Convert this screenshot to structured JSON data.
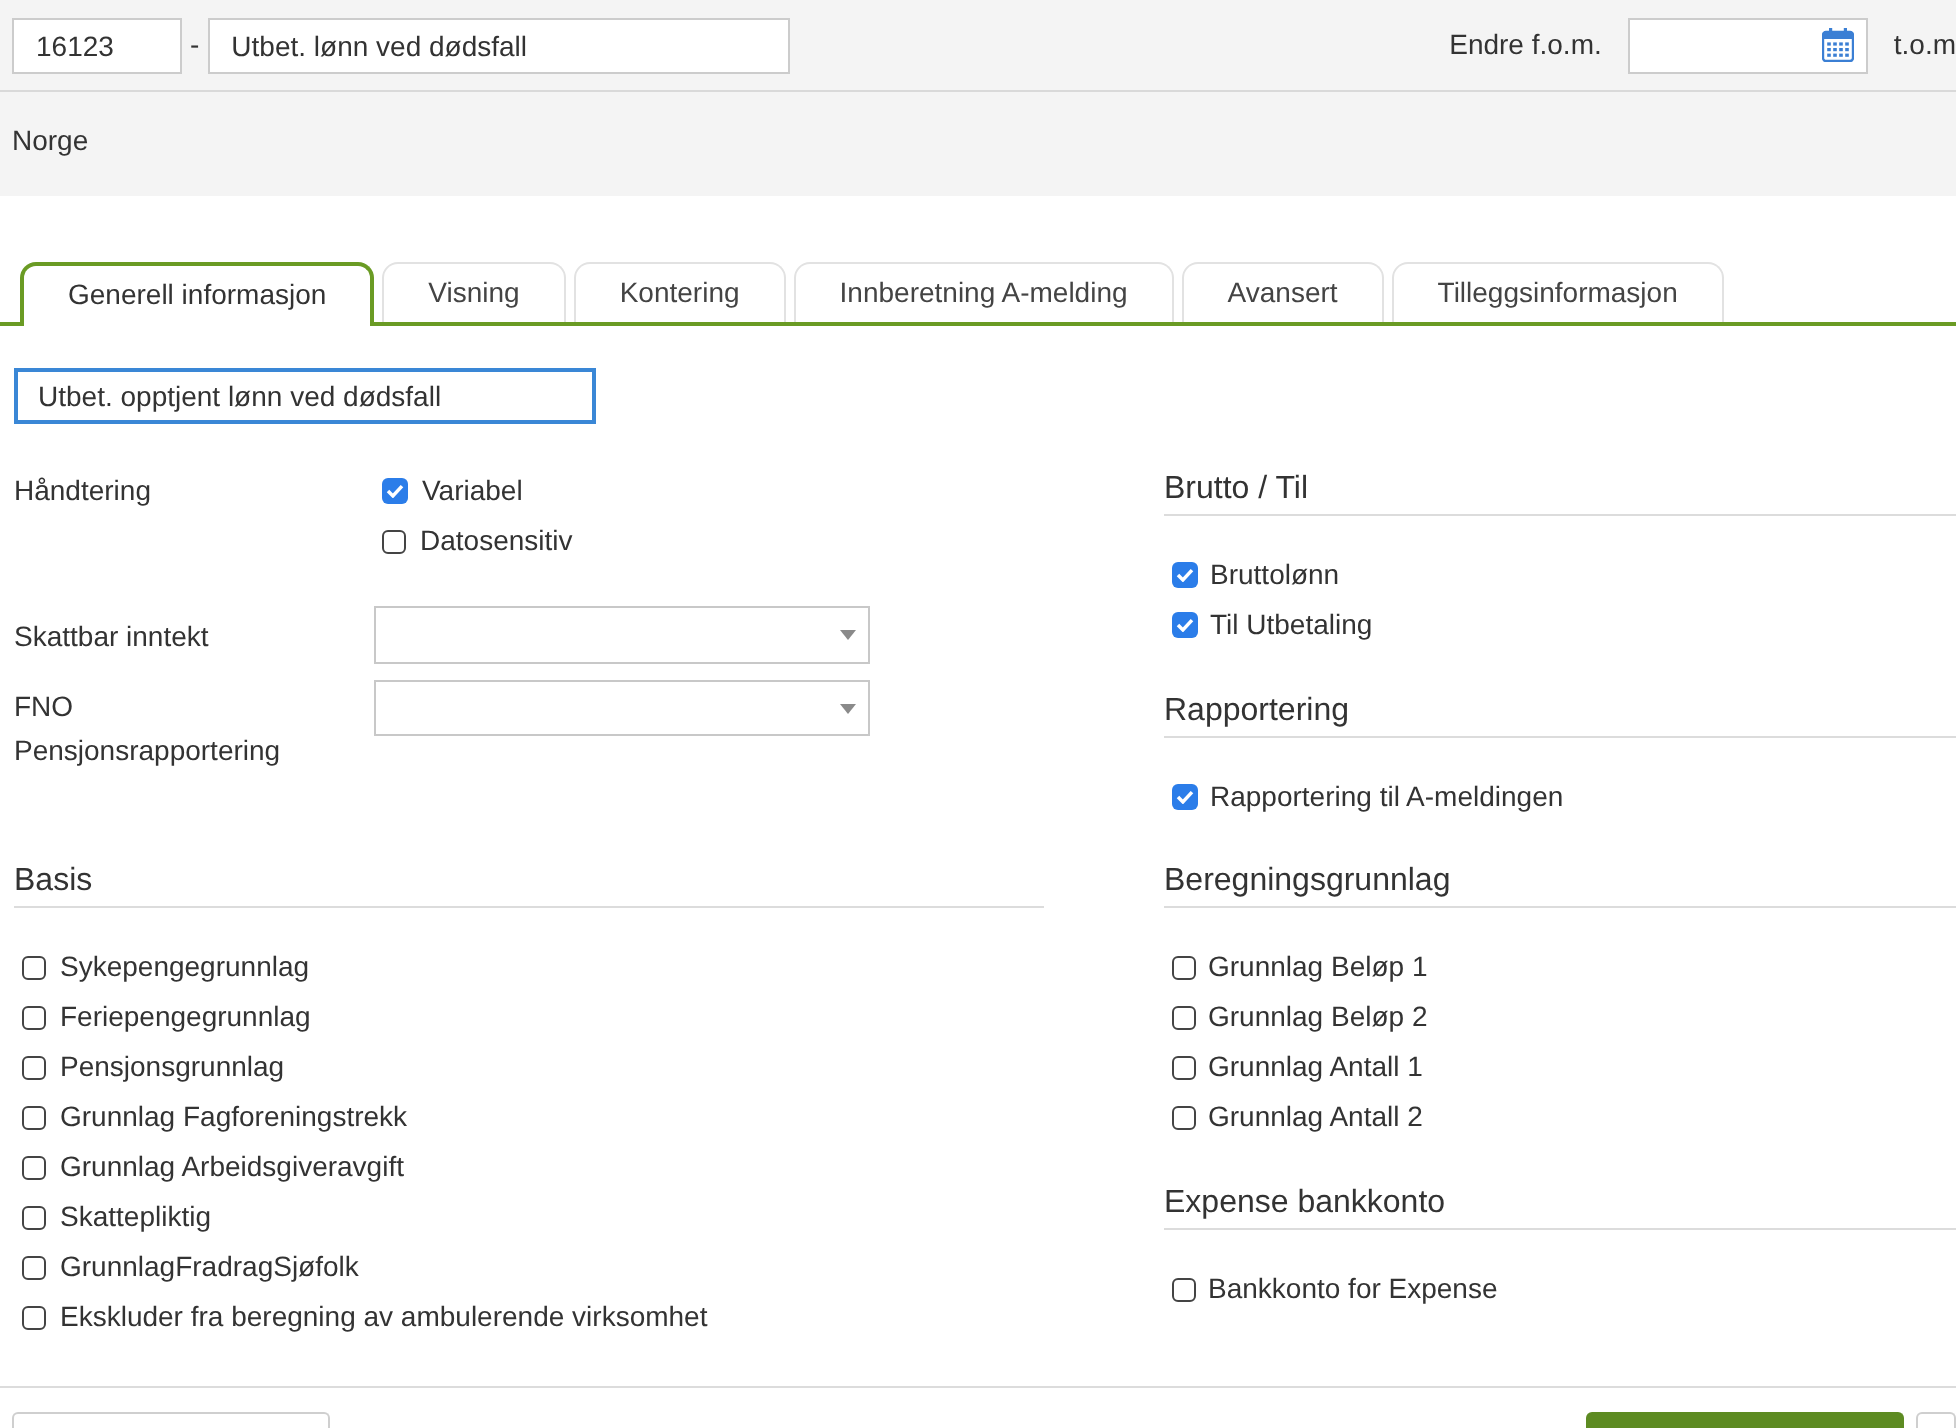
{
  "header": {
    "code": "16123",
    "separator": "-",
    "name": "Utbet. lønn ved dødsfall",
    "date_from": {
      "label": "Endre f.o.m."
    },
    "date_to": {
      "label": "t.o.m"
    }
  },
  "country": "Norge",
  "tabs": [
    {
      "label": "Generell informasjon",
      "selected": true
    },
    {
      "label": "Visning",
      "selected": false
    },
    {
      "label": "Kontering",
      "selected": false
    },
    {
      "label": "Innberetning A-melding",
      "selected": false
    },
    {
      "label": "Avansert",
      "selected": false
    },
    {
      "label": "Tilleggsinformasjon",
      "selected": false
    }
  ],
  "description": {
    "value": "Utbet. opptjent lønn ved dødsfall",
    "focused": true
  },
  "handling": {
    "label": "Håndtering",
    "options": [
      {
        "label": "Variabel",
        "checked": true
      },
      {
        "label": "Datosensitiv",
        "checked": false
      }
    ]
  },
  "selects": [
    {
      "label": "Skattbar inntekt"
    },
    {
      "label": "FNO Pensjonsrapportering"
    }
  ],
  "left_sections": [
    {
      "title": "Basis",
      "items": [
        {
          "label": "Sykepengegrunnlag",
          "checked": false
        },
        {
          "label": "Feriepengegrunnlag",
          "checked": false
        },
        {
          "label": "Pensjonsgrunnlag",
          "checked": false
        },
        {
          "label": "Grunnlag Fagforeningstrekk",
          "checked": false
        },
        {
          "label": "Grunnlag Arbeidsgiveravgift",
          "checked": false
        },
        {
          "label": "Skattepliktig",
          "checked": false
        },
        {
          "label": "GrunnlagFradragSjøfolk",
          "checked": false
        },
        {
          "label": "Ekskluder fra beregning av ambulerende virksomhet",
          "checked": false
        }
      ]
    }
  ],
  "right_sections_top": [
    {
      "title": "Brutto / Til",
      "items": [
        {
          "label": "Bruttolønn",
          "checked": true
        },
        {
          "label": "Til Utbetaling",
          "checked": true
        }
      ]
    },
    {
      "title": "Rapportering",
      "items": [
        {
          "label": "Rapportering til A-meldingen",
          "checked": true
        }
      ]
    }
  ],
  "right_sections_bottom": [
    {
      "title": "Beregningsgrunnlag",
      "items": [
        {
          "label": "Grunnlag Beløp 1",
          "checked": false
        },
        {
          "label": "Grunnlag Beløp 2",
          "checked": false
        },
        {
          "label": "Grunnlag Antall 1",
          "checked": false
        },
        {
          "label": "Grunnlag Antall 2",
          "checked": false
        }
      ]
    },
    {
      "title": "Expense bankkonto",
      "items": [
        {
          "label": "Bankkonto for Expense",
          "checked": false
        }
      ]
    }
  ],
  "footer_buttons": [
    {
      "kind": "secondary"
    },
    {
      "kind": "primary"
    },
    {
      "kind": "secondary"
    }
  ]
}
